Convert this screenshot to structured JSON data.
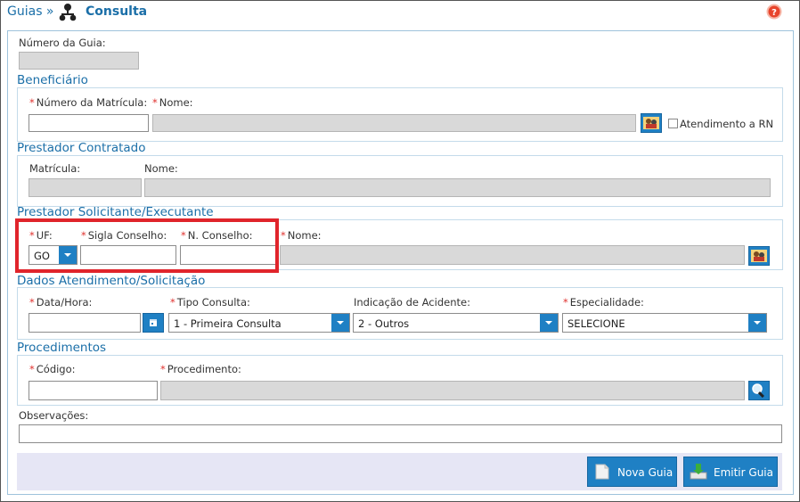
{
  "header": {
    "breadcrumb_root": "Guias »",
    "title": "Consulta"
  },
  "guia": {
    "numero_label": "Número da Guia:"
  },
  "beneficiario": {
    "section": "Beneficiário",
    "matricula_label": "Número da Matrícula:",
    "nome_label": "Nome:",
    "rn_label": "Atendimento a RN"
  },
  "contratado": {
    "section": "Prestador Contratado",
    "matricula_label": "Matrícula:",
    "nome_label": "Nome:"
  },
  "solicitante": {
    "section": "Prestador Solicitante/Executante",
    "uf_label": "UF:",
    "uf_value": "GO",
    "sigla_label": "Sigla Conselho:",
    "nconselho_label": "N. Conselho:",
    "nome_label": "Nome:"
  },
  "atendimento": {
    "section": "Dados Atendimento/Solicitação",
    "datahora_label": "Data/Hora:",
    "tipo_label": "Tipo Consulta:",
    "tipo_value": "1 - Primeira Consulta",
    "acidente_label": "Indicação de Acidente:",
    "acidente_value": "2 - Outros",
    "especialidade_label": "Especialidade:",
    "especialidade_value": "SELECIONE"
  },
  "procedimentos": {
    "section": "Procedimentos",
    "codigo_label": "Código:",
    "procedimento_label": "Procedimento:"
  },
  "observacoes": {
    "label": "Observações:"
  },
  "actions": {
    "nova_guia": "Nova Guia",
    "emitir_guia": "Emitir Guia"
  },
  "required_marker": "*",
  "colors": {
    "accent": "#1f80c4",
    "section_text": "#1b6fa8",
    "required": "#e0312e",
    "highlight": "#e0242b",
    "help": "#e8442b"
  }
}
